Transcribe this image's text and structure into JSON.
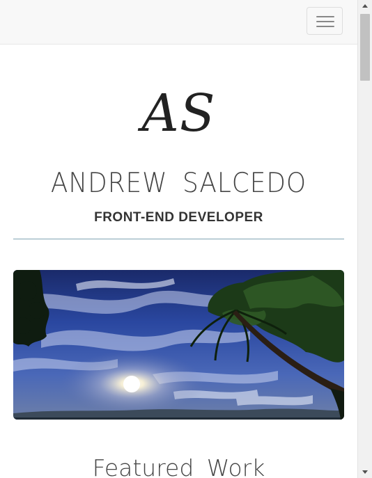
{
  "navbar": {
    "toggle_icon": "hamburger-menu-icon"
  },
  "header": {
    "monogram": "AS",
    "name": "ANDREW SALCEDO",
    "role": "FRONT-END DEVELOPER"
  },
  "hero": {
    "image": "tropical-sky-palm-tree-sunset"
  },
  "featured": {
    "title": "Featured Work"
  },
  "colors": {
    "navbar_bg": "#f8f8f8",
    "divider": "#7fa3b3",
    "text_dark": "#333333",
    "text_light": "#444444"
  }
}
